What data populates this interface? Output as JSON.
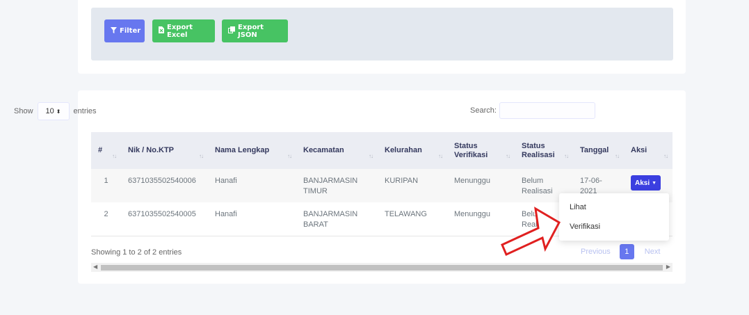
{
  "toolbar": {
    "filter_label": "Filter",
    "export_excel_label": "Export Excel",
    "export_json_label": "Export JSON"
  },
  "controls": {
    "show_label": "Show",
    "page_length": "10",
    "entries_label": "entries",
    "search_label": "Search:",
    "search_value": ""
  },
  "table": {
    "headers": [
      "#",
      "Nik / No.KTP",
      "Nama Lengkap",
      "Kecamatan",
      "Kelurahan",
      "Status Verifikasi",
      "Status Realisasi",
      "Tanggal",
      "Aksi"
    ],
    "rows": [
      {
        "no": "1",
        "nik": "6371035502540006",
        "nama": "Hanafi",
        "kecamatan": "BANJARMASIN TIMUR",
        "kelurahan": "KURIPAN",
        "status_verifikasi": "Menunggu",
        "status_realisasi": "Belum Realisasi",
        "tanggal": "17-06-2021",
        "aksi": "Aksi"
      },
      {
        "no": "2",
        "nik": "6371035502540005",
        "nama": "Hanafi",
        "kecamatan": "BANJARMASIN BARAT",
        "kelurahan": "TELAWANG",
        "status_verifikasi": "Menunggu",
        "status_realisasi": "Belum Realisasi",
        "tanggal": "",
        "aksi": ""
      }
    ]
  },
  "dropdown": {
    "items": [
      "Lihat",
      "Verifikasi"
    ]
  },
  "footer": {
    "info": "Showing 1 to 2 of 2 entries",
    "previous": "Previous",
    "current_page": "1",
    "next": "Next"
  },
  "colors": {
    "primary": "#6777ef",
    "success": "#47c363",
    "action": "#3b3fe0",
    "annotation_arrow": "#e02020"
  },
  "icons": {
    "filter": "filter-icon",
    "excel": "file-excel-icon",
    "json": "copy-icon",
    "sort": "sort-icon",
    "caret": "caret-down-icon"
  }
}
